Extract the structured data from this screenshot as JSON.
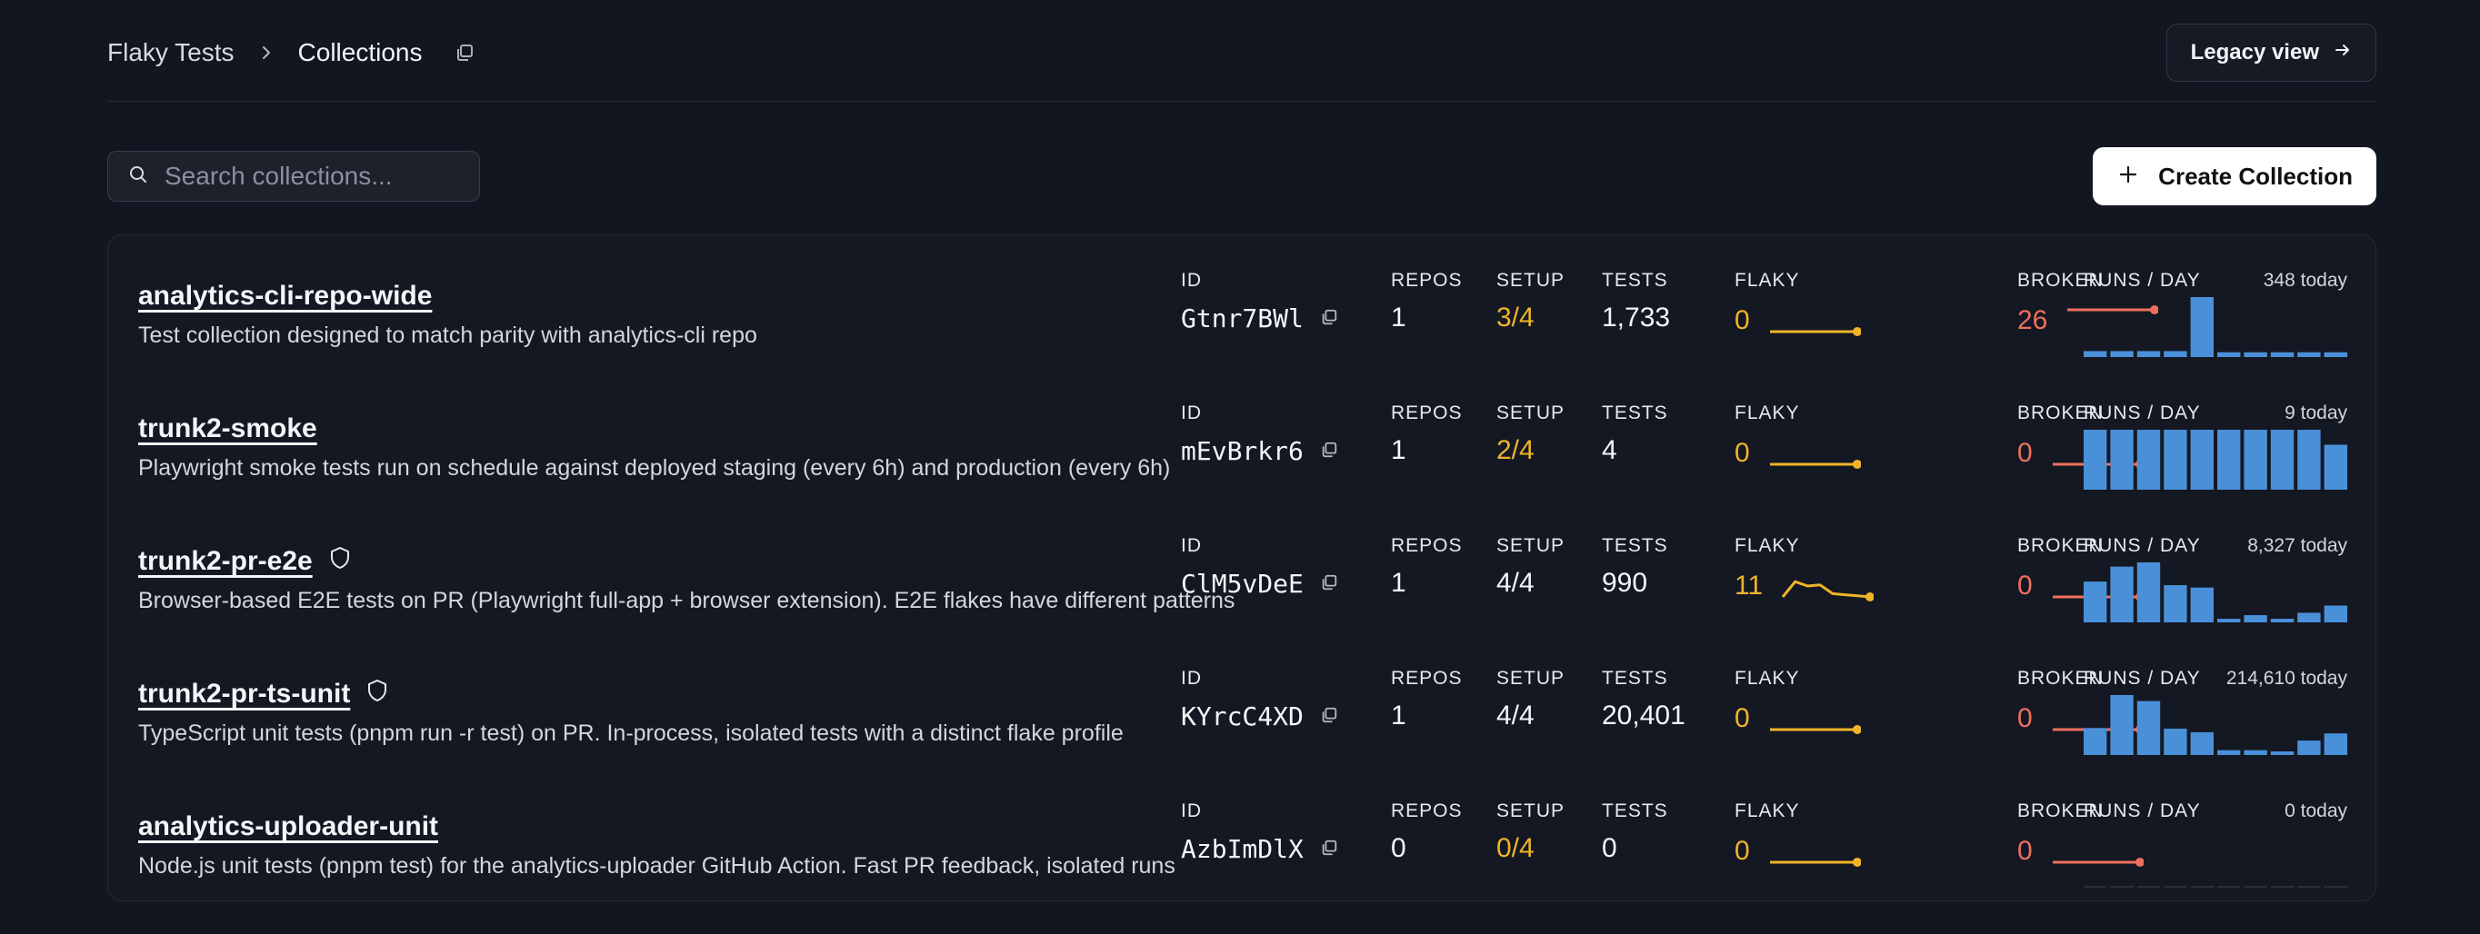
{
  "breadcrumb": {
    "root": "Flaky Tests",
    "current": "Collections"
  },
  "header": {
    "legacy_label": "Legacy view"
  },
  "search": {
    "placeholder": "Search collections..."
  },
  "create": {
    "label": "Create Collection"
  },
  "columns": {
    "id": "ID",
    "repos": "REPOS",
    "setup": "SETUP",
    "tests": "TESTS",
    "flaky": "FLAKY",
    "broken": "BROKEN",
    "runs": "RUNS / DAY"
  },
  "colors": {
    "yellow": "#f0b429",
    "red": "#ef6f5e",
    "blue": "#4a90d9",
    "bg": "#121620"
  },
  "rows": [
    {
      "name": "analytics-cli-repo-wide",
      "shield": false,
      "description": "Test collection designed to match parity with analytics-cli repo",
      "id": "Gtnr7BWl",
      "repos": "1",
      "setup": "3/4",
      "setup_warn": true,
      "tests": "1,733",
      "flaky": "0",
      "broken": "26",
      "today": "348 today",
      "flaky_trend": [
        0,
        0,
        0,
        0,
        0,
        0,
        0,
        0
      ],
      "broken_trend": [
        1,
        1,
        1,
        1,
        1,
        1,
        1,
        1
      ],
      "runs_per_day": [
        0.1,
        0.1,
        0.1,
        0.1,
        1.0,
        0.08,
        0.08,
        0.08,
        0.08,
        0.08
      ]
    },
    {
      "name": "trunk2-smoke",
      "shield": false,
      "description": "Playwright smoke tests run on schedule against deployed staging (every 6h) and production (every 6h)",
      "id": "mEvBrkr6",
      "repos": "1",
      "setup": "2/4",
      "setup_warn": true,
      "tests": "4",
      "flaky": "0",
      "broken": "0",
      "today": "9 today",
      "flaky_trend": [
        0,
        0,
        0,
        0,
        0,
        0,
        0,
        0
      ],
      "broken_trend": [
        0,
        0,
        0,
        0,
        0,
        0,
        0,
        0
      ],
      "runs_per_day": [
        1,
        1,
        1,
        1,
        1,
        1,
        1,
        1,
        1,
        0.75
      ]
    },
    {
      "name": "trunk2-pr-e2e",
      "shield": true,
      "description": "Browser-based E2E tests on PR (Playwright full-app + browser extension). E2E flakes have different patterns",
      "id": "ClM5vDeE",
      "repos": "1",
      "setup": "4/4",
      "setup_warn": false,
      "tests": "990",
      "flaky": "11",
      "broken": "0",
      "today": "8,327 today",
      "flaky_trend": [
        0,
        0.7,
        0.5,
        0.55,
        0.15,
        0.1,
        0.05,
        0.0
      ],
      "broken_trend": [
        0,
        0,
        0,
        0,
        0,
        0,
        0,
        0
      ],
      "runs_per_day": [
        0.68,
        0.93,
        1.0,
        0.62,
        0.58,
        0.06,
        0.12,
        0.06,
        0.16,
        0.28
      ]
    },
    {
      "name": "trunk2-pr-ts-unit",
      "shield": true,
      "description": "TypeScript unit tests (pnpm run -r test) on PR. In-process, isolated tests with a distinct flake profile",
      "id": "KYrcC4XD",
      "repos": "1",
      "setup": "4/4",
      "setup_warn": false,
      "tests": "20,401",
      "flaky": "0",
      "broken": "0",
      "today": "214,610 today",
      "flaky_trend": [
        0,
        0,
        0,
        0,
        0,
        0,
        0,
        0
      ],
      "broken_trend": [
        0,
        0,
        0,
        0,
        0,
        0,
        0,
        0
      ],
      "runs_per_day": [
        0.45,
        1.0,
        0.9,
        0.44,
        0.38,
        0.08,
        0.08,
        0.06,
        0.24,
        0.36
      ]
    },
    {
      "name": "analytics-uploader-unit",
      "shield": false,
      "description": "Node.js unit tests (pnpm test) for the analytics-uploader GitHub Action. Fast PR feedback, isolated runs",
      "id": "AzbImDlX",
      "repos": "0",
      "setup": "0/4",
      "setup_warn": true,
      "tests": "0",
      "flaky": "0",
      "broken": "0",
      "today": "0 today",
      "flaky_trend": [
        0,
        0,
        0,
        0,
        0,
        0,
        0,
        0
      ],
      "broken_trend": [
        0,
        0,
        0,
        0,
        0,
        0,
        0,
        0
      ],
      "runs_per_day": [
        0,
        0,
        0,
        0,
        0,
        0,
        0,
        0,
        0,
        0
      ]
    }
  ]
}
